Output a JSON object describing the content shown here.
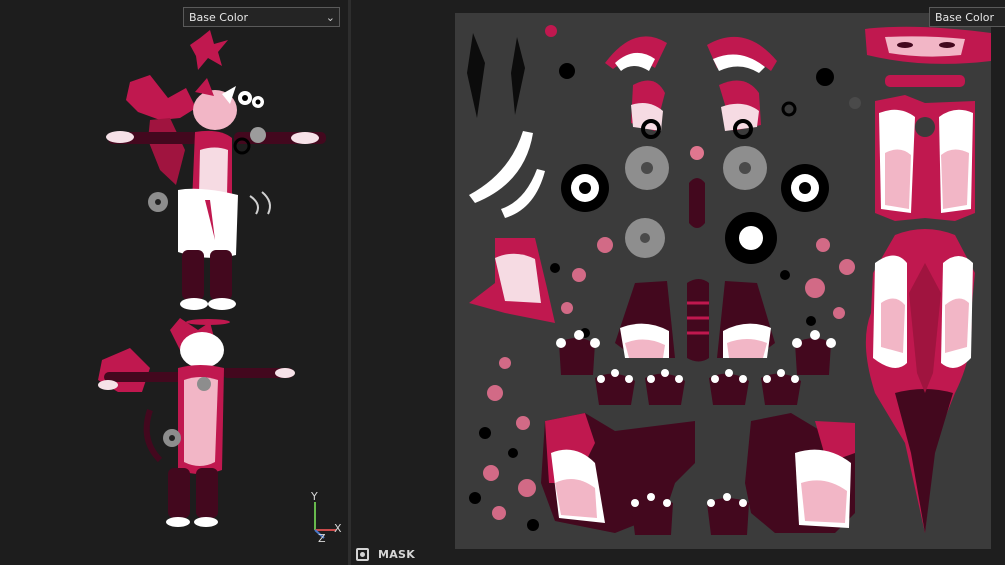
{
  "viewport_3d": {
    "channel_select": {
      "value": "Base Color",
      "chevron": "chevron-down-icon"
    },
    "axis_gizmo": {
      "y_label": "Y",
      "x_label": "X",
      "z_label": "Z"
    }
  },
  "uv_view": {
    "channel_select": {
      "value": "Base Color"
    },
    "mask_toggle": {
      "label": "MASK",
      "icon": "mask-icon"
    }
  },
  "colors": {
    "crimson": "#c0184f",
    "dark_maroon": "#43081e",
    "blush_pink": "#f2b6c6",
    "white": "#ffffff",
    "uv_background": "#3b3b3b",
    "panel_background": "#1d1d1d"
  }
}
